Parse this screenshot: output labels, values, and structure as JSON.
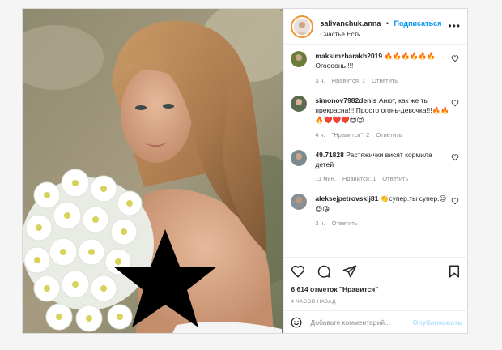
{
  "post": {
    "username": "salivanchuk.anna",
    "dot": "•",
    "follow_label": "Подписаться",
    "location": "Счастье Есть",
    "more": "•••"
  },
  "comments": [
    {
      "user": "maksimzbarakh2019",
      "text": "🔥🔥🔥🔥🔥🔥 Огоооонь !!!",
      "time": "3 ч.",
      "likes": "Нравится: 1",
      "reply": "Ответить",
      "avatar_color": "#6b7d3a"
    },
    {
      "user": "simonov7982denis",
      "text": "Анют, как же ты прекрасна!!! Просто огонь-девочка!!!🔥🔥🔥❤️❤️❤️😍😍",
      "time": "4 ч.",
      "likes": "\"Нравится\": 2",
      "reply": "Ответить",
      "avatar_color": "#5a6b4f"
    },
    {
      "user": "49.71828",
      "text": "Растяжички висят кормила детей",
      "time": "11 мин.",
      "likes": "Нравится: 1",
      "reply": "Ответить",
      "avatar_color": "#7a8a8f"
    },
    {
      "user": "aleksejpetrovskij81",
      "text": "👏супер.ты супер.😉😉😘",
      "time": "3 ч.",
      "likes": "",
      "reply": "Ответить",
      "avatar_color": "#8a8f93"
    }
  ],
  "stats": {
    "likes_text": "6 614 отметок \"Нравится\"",
    "time_ago": "4 ЧАСОВ НАЗАД"
  },
  "add_comment": {
    "placeholder": "Добавьте комментарий...",
    "publish": "Опубликовать"
  },
  "icons": {
    "like": "heart-icon",
    "comment": "comment-icon",
    "share": "share-icon",
    "save": "bookmark-icon",
    "emoji": "smile-icon"
  },
  "colors": {
    "link_blue": "#0095f6",
    "publish_disabled": "#b2dffc",
    "meta_gray": "#8e8e8e"
  }
}
